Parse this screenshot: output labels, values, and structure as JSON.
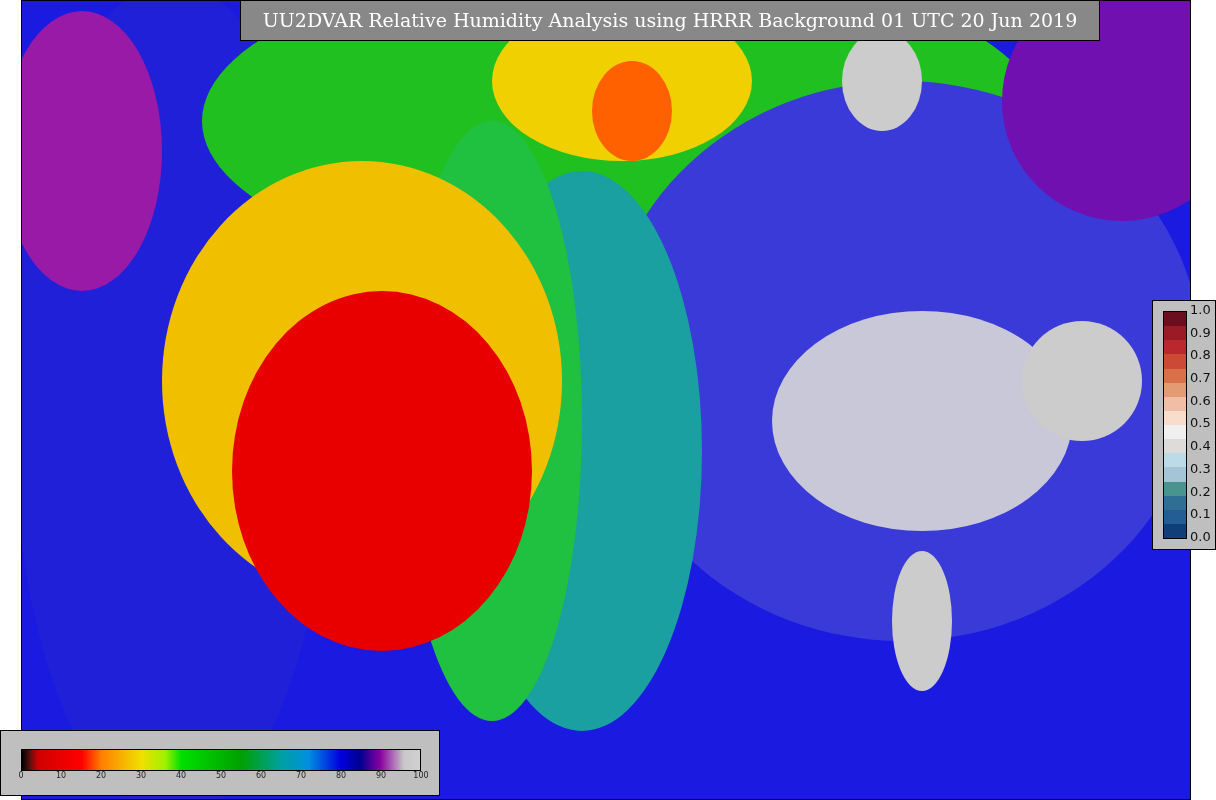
{
  "title": "UU2DVAR Relative Humidity Analysis using HRRR Background 01 UTC 20 Jun 2019",
  "humidity_colorbar": {
    "ticks": [
      "0",
      "10",
      "20",
      "30",
      "40",
      "50",
      "60",
      "70",
      "80",
      "90",
      "100"
    ]
  },
  "ratio_colorbar": {
    "ticks": [
      "1.0",
      "0.9",
      "0.8",
      "0.7",
      "0.6",
      "0.5",
      "0.4",
      "0.3",
      "0.2",
      "0.1",
      "0.0"
    ]
  }
}
